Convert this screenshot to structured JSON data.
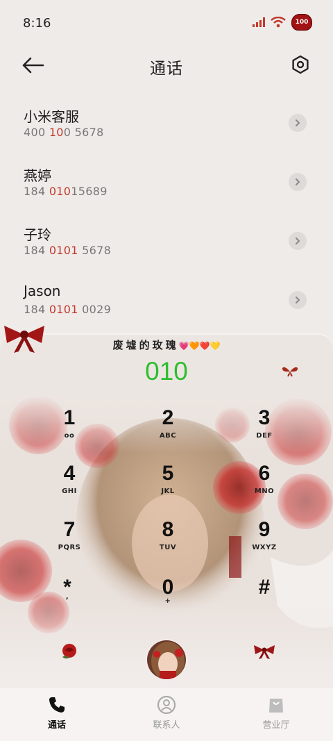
{
  "status": {
    "time": "8:16",
    "battery": "100"
  },
  "header": {
    "title": "通话"
  },
  "contacts": [
    {
      "name": "小米客服",
      "number_parts": [
        "400 ",
        "10",
        "0 5678"
      ]
    },
    {
      "name": "燕婷",
      "number_parts": [
        "184 ",
        "010",
        "15689"
      ]
    },
    {
      "name": "子玲",
      "number_parts": [
        "184 ",
        "0101",
        " 5678"
      ]
    },
    {
      "name": "Jason",
      "number_parts": [
        "184 ",
        "0101",
        " 0029"
      ]
    }
  ],
  "dialer": {
    "banner": "废墟的玫瑰",
    "banner_hearts": "💗🧡❤️💛",
    "dialed": "010",
    "keys": [
      {
        "digit": "1",
        "letters": "oo"
      },
      {
        "digit": "2",
        "letters": "ABC"
      },
      {
        "digit": "3",
        "letters": "DEF"
      },
      {
        "digit": "4",
        "letters": "GHI"
      },
      {
        "digit": "5",
        "letters": "JKL"
      },
      {
        "digit": "6",
        "letters": "MNO"
      },
      {
        "digit": "7",
        "letters": "PQRS"
      },
      {
        "digit": "8",
        "letters": "TUV"
      },
      {
        "digit": "9",
        "letters": "WXYZ"
      },
      {
        "digit": "*",
        "letters": ","
      },
      {
        "digit": "0",
        "letters": "+"
      },
      {
        "digit": "#",
        "letters": ""
      }
    ]
  },
  "nav": {
    "items": [
      {
        "label": "通话",
        "icon": "phone-icon"
      },
      {
        "label": "联系人",
        "icon": "person-icon"
      },
      {
        "label": "营业厅",
        "icon": "bag-icon"
      }
    ]
  },
  "colors": {
    "accent_green": "#2dbe2d",
    "highlight_red": "#c0392b",
    "rose_red": "#a21313"
  }
}
